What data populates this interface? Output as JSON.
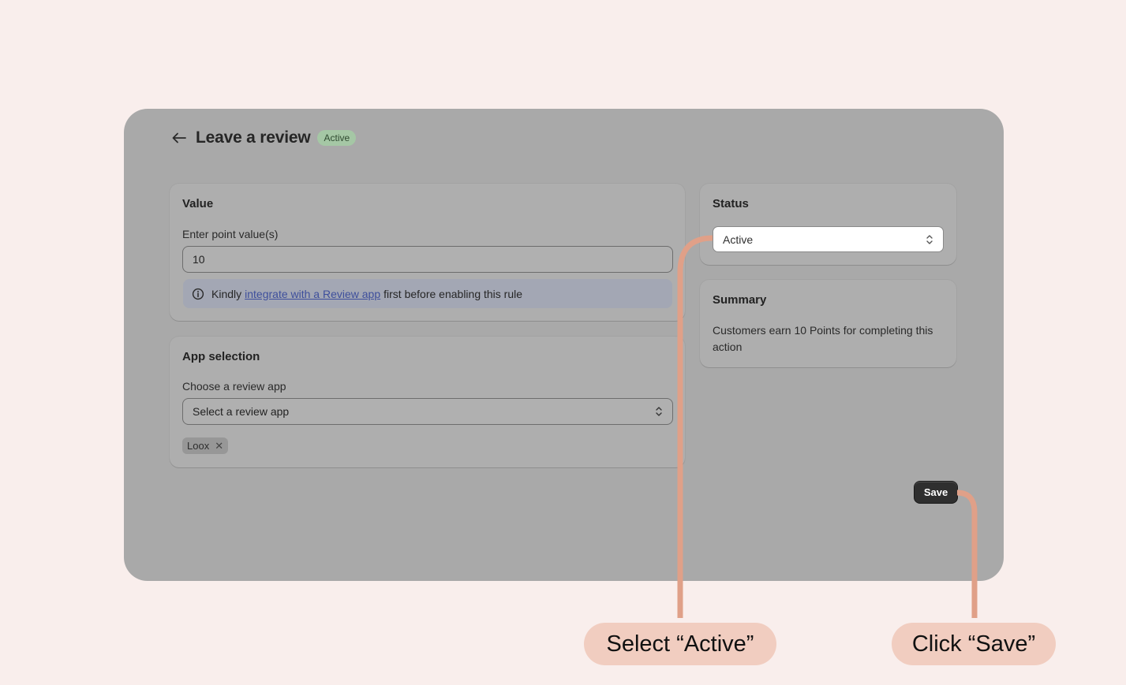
{
  "header": {
    "title": "Leave a review",
    "badge": "Active"
  },
  "value_card": {
    "title": "Value",
    "field_label": "Enter point value(s)",
    "field_value": "10",
    "banner_prefix": "Kindly",
    "banner_link": "integrate with a Review app",
    "banner_suffix": "first before enabling this rule"
  },
  "app_card": {
    "title": "App selection",
    "field_label": "Choose a review app",
    "select_value": "Select a review app",
    "tags": [
      "Loox"
    ]
  },
  "status_card": {
    "title": "Status",
    "select_value": "Active"
  },
  "summary_card": {
    "title": "Summary",
    "text": "Customers earn 10 Points for completing this action"
  },
  "actions": {
    "save_label": "Save"
  },
  "callouts": {
    "select_active": "Select “Active”",
    "click_save": "Click “Save”"
  },
  "colors": {
    "background": "#f9eeec",
    "overlay": "#a9a9a9",
    "connector": "#e0a088",
    "callout_bg": "#f1cdc0"
  }
}
